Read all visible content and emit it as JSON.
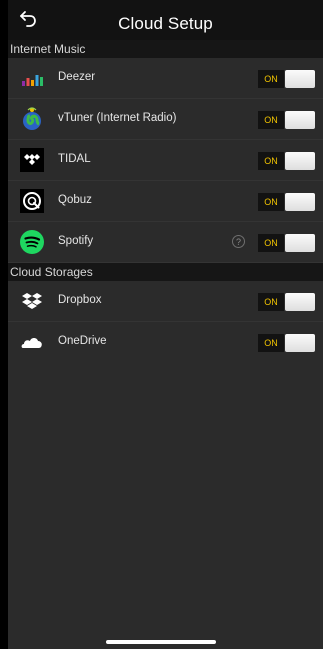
{
  "header": {
    "title": "Cloud Setup",
    "back_icon": "back-arrow-icon"
  },
  "sections": [
    {
      "title": "Internet Music",
      "items": [
        {
          "label": "Deezer",
          "icon": "deezer-icon",
          "toggle": "ON"
        },
        {
          "label": "vTuner (Internet Radio)",
          "icon": "vtuner-icon",
          "toggle": "ON"
        },
        {
          "label": "TIDAL",
          "icon": "tidal-icon",
          "toggle": "ON"
        },
        {
          "label": "Qobuz",
          "icon": "qobuz-icon",
          "toggle": "ON"
        },
        {
          "label": "Spotify",
          "icon": "spotify-icon",
          "toggle": "ON",
          "help": "?"
        }
      ]
    },
    {
      "title": "Cloud Storages",
      "items": [
        {
          "label": "Dropbox",
          "icon": "dropbox-icon",
          "toggle": "ON"
        },
        {
          "label": "OneDrive",
          "icon": "onedrive-icon",
          "toggle": "ON"
        }
      ]
    }
  ],
  "colors": {
    "background": "#2b2b2b",
    "header": "#121212",
    "section_bar": "#161616",
    "toggle_on_text": "#f2c400"
  }
}
